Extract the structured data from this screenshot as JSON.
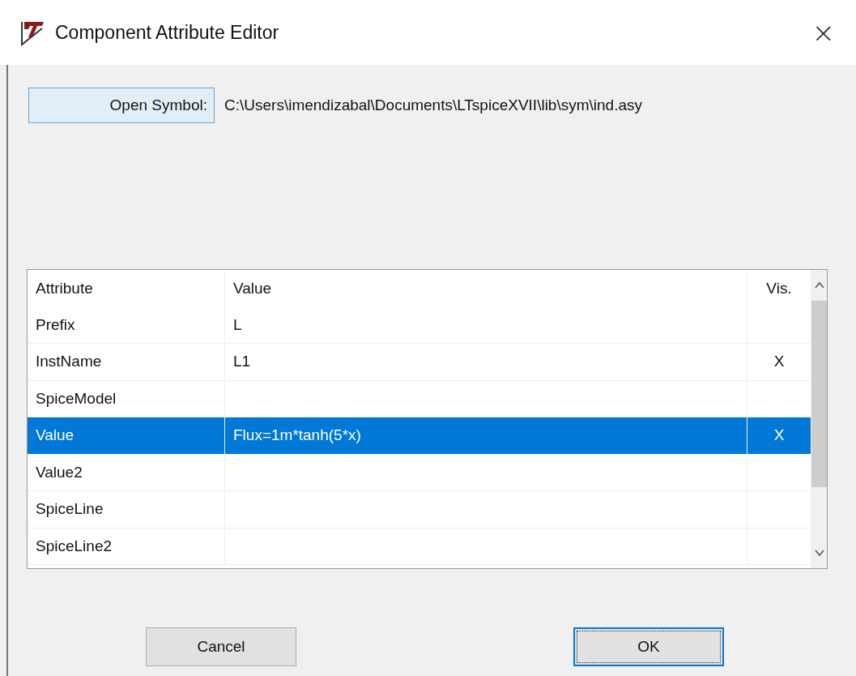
{
  "window": {
    "title": "Component Attribute Editor",
    "close": "×"
  },
  "open_symbol": {
    "label": "Open Symbol:",
    "path": "C:\\Users\\imendizabal\\Documents\\LTspiceXVII\\lib\\sym\\ind.asy"
  },
  "table": {
    "columns": [
      "Attribute",
      "Value",
      "Vis."
    ],
    "rows": [
      {
        "attribute": "Prefix",
        "value": "L",
        "selected": false
      },
      {
        "attribute": "InstName",
        "value": "L1",
        "vis": "X",
        "selected": false
      },
      {
        "attribute": "SpiceModel",
        "selected": false
      },
      {
        "attribute": "Value",
        "value": "Flux=1m*tanh(5*x)",
        "vis": "X",
        "selected": true
      },
      {
        "attribute": "Value2",
        "selected": false
      },
      {
        "attribute": "SpiceLine",
        "selected": false
      },
      {
        "attribute": "SpiceLine2",
        "selected": false
      }
    ]
  },
  "buttons": [
    {
      "label": "Cancel",
      "kind": "cancel"
    },
    {
      "label": "OK",
      "kind": "ok"
    }
  ]
}
